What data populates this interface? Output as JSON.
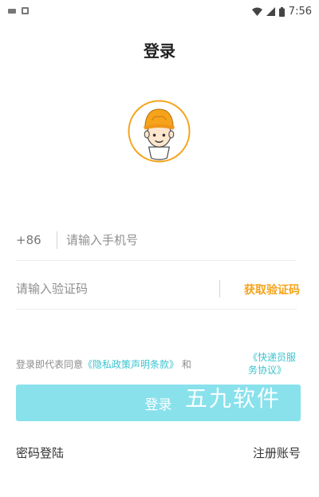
{
  "status_bar": {
    "time": "7:56",
    "icons": [
      "notification-icon",
      "gallery-icon",
      "wifi-icon",
      "signal-icon",
      "battery-icon"
    ]
  },
  "page": {
    "title": "登录"
  },
  "phone": {
    "prefix": "+86",
    "placeholder": "请输入手机号"
  },
  "code": {
    "placeholder": "请输入验证码",
    "get_code_label": "获取验证码"
  },
  "agreement": {
    "prefix": "登录即代表同意",
    "privacy_link": "《隐私政策声明条款》",
    "conjunction": "和",
    "courier_link": "《快递员服务协议》"
  },
  "login_button": {
    "label": "登录"
  },
  "watermark": "五九软件",
  "footer": {
    "password_login": "密码登陆",
    "register": "注册账号"
  },
  "colors": {
    "accent": "#89e1ec",
    "link": "#3ac4cf",
    "orange": "#f5a31a"
  }
}
